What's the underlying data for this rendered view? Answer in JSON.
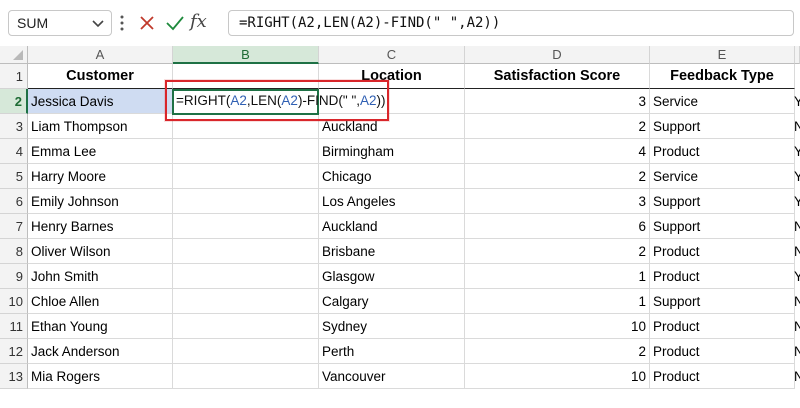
{
  "formula_bar": {
    "name_box": "SUM",
    "formula": "=RIGHT(A2,LEN(A2)-FIND(\" \",A2))",
    "fx_label": "fx",
    "icons": {
      "cancel": "x-icon",
      "confirm": "check-icon",
      "function": "fx-icon",
      "more": "vertical-dots-icon",
      "dropdown": "chevron-down-icon"
    }
  },
  "columns": [
    "A",
    "B",
    "C",
    "D",
    "E"
  ],
  "row_numbers": [
    "1",
    "2",
    "3",
    "4",
    "5",
    "6",
    "7",
    "8",
    "9",
    "10",
    "11",
    "12",
    "13"
  ],
  "headers": {
    "customer": "Customer",
    "location": "Location",
    "score": "Satisfaction Score",
    "feedback": "Feedback Type"
  },
  "active_cell": {
    "prefix": "=RIGHT(",
    "ref1": "A2",
    "mid": ",LEN(",
    "ref2": "A2",
    "mid2": ")-FIND(\" \",",
    "ref3": "A2",
    "suffix": "))"
  },
  "rows": [
    {
      "customer": "Jessica Davis",
      "location": "",
      "score": "3",
      "feedback": "Service",
      "f_partial": "Y"
    },
    {
      "customer": "Liam Thompson",
      "location": "Auckland",
      "score": "2",
      "feedback": "Support",
      "f_partial": "N"
    },
    {
      "customer": "Emma Lee",
      "location": "Birmingham",
      "score": "4",
      "feedback": "Product",
      "f_partial": "Y"
    },
    {
      "customer": "Harry Moore",
      "location": "Chicago",
      "score": "2",
      "feedback": "Service",
      "f_partial": "Y"
    },
    {
      "customer": "Emily Johnson",
      "location": "Los Angeles",
      "score": "3",
      "feedback": "Support",
      "f_partial": "Y"
    },
    {
      "customer": "Henry Barnes",
      "location": "Auckland",
      "score": "6",
      "feedback": "Support",
      "f_partial": "N"
    },
    {
      "customer": "Oliver Wilson",
      "location": "Brisbane",
      "score": "2",
      "feedback": "Product",
      "f_partial": "N"
    },
    {
      "customer": "John Smith",
      "location": "Glasgow",
      "score": "1",
      "feedback": "Product",
      "f_partial": "Y"
    },
    {
      "customer": "Chloe Allen",
      "location": "Calgary",
      "score": "1",
      "feedback": "Support",
      "f_partial": "N"
    },
    {
      "customer": "Ethan Young",
      "location": "Sydney",
      "score": "10",
      "feedback": "Product",
      "f_partial": "N"
    },
    {
      "customer": "Jack Anderson",
      "location": "Perth",
      "score": "2",
      "feedback": "Product",
      "f_partial": "N"
    },
    {
      "customer": "Mia Rogers",
      "location": "Vancouver",
      "score": "10",
      "feedback": "Product",
      "f_partial": "N"
    }
  ],
  "colors": {
    "accent_green": "#1e7145",
    "highlight_red": "#d9262b",
    "ref_blue": "#2f5fb3",
    "a2_fill": "#cfdcf2"
  }
}
